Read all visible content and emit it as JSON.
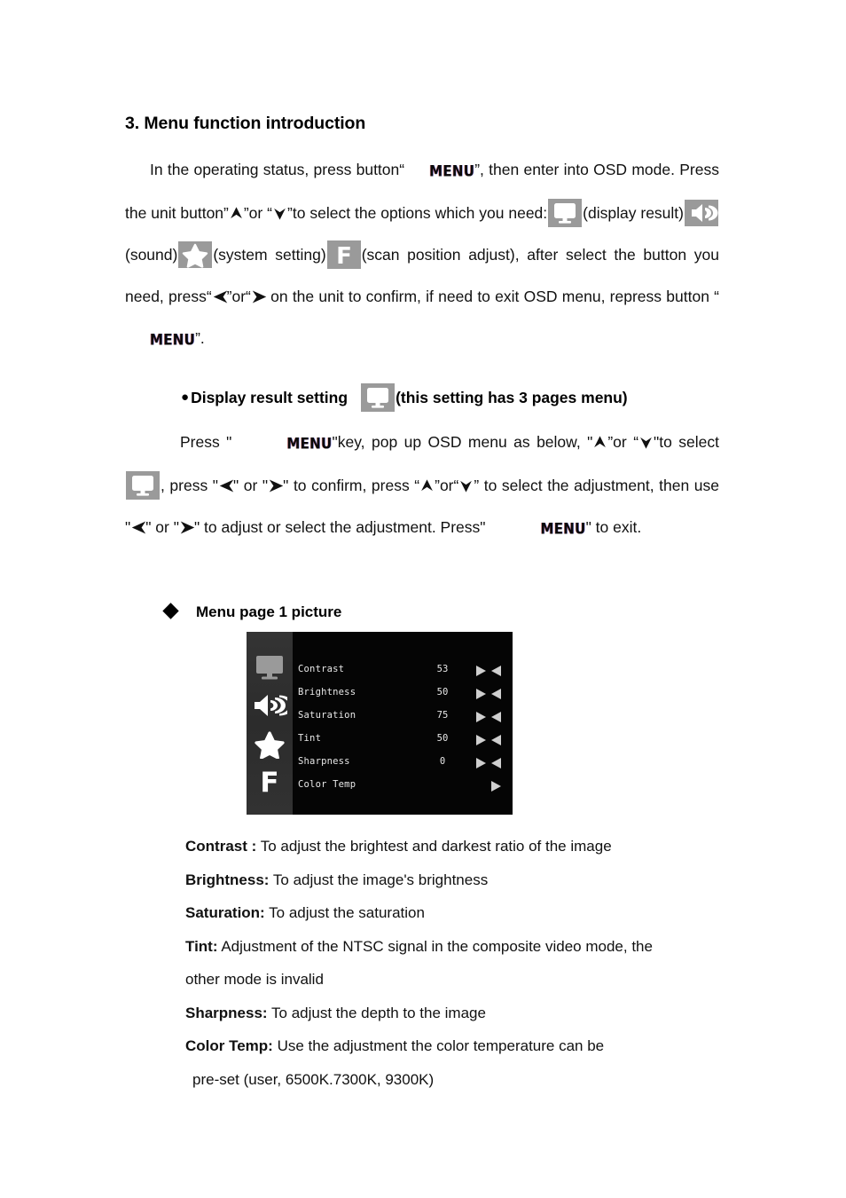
{
  "document": {
    "section_title": "3. Menu function introduction",
    "intro": {
      "seg1": "In the operating status, press button",
      "quote_open": "“",
      "menu_key": "MENU",
      "quote_close": "”",
      "seg2": ", then enter into OSD mode. Press the unit button”",
      "seg3": "”or “",
      "seg4": "”to select the options which you need:",
      "seg5": "(display result)",
      "seg6": "(sound)",
      "seg7": "(system setting)",
      "seg8": "(scan position adjust), after select the button you need, press“",
      "seg9": "”or“",
      "seg10": " on the unit to confirm, if need to exit OSD menu, repress button “",
      "seg11": "”."
    },
    "bullet_heading": {
      "bullet": "●",
      "text": "Display result setting",
      "suffix": "(this setting has 3 pages menu)"
    },
    "press_para": {
      "seg1": "Press \"",
      "menu_key": "MENU",
      "seg2": "\"key, pop up OSD menu as below, \"",
      "seg3": "”or “",
      "seg4": "\"to select",
      "seg5": ", press \"",
      "seg6": "\" or \"",
      "seg7": "\" to confirm, press “",
      "seg8": "”or“",
      "seg9": "” to select the adjustment, then use \"",
      "seg10": "\" or \"",
      "seg11": "\" to adjust or select the adjustment. Press\"",
      "seg12": "\" to exit."
    },
    "menu_page_caption": "Menu page 1 picture",
    "descriptions": [
      {
        "term": "Contrast :",
        "text": "To adjust the brightest and darkest ratio of the image"
      },
      {
        "term": "Brightness:",
        "text": "To adjust the image's brightness"
      },
      {
        "term": "Saturation:",
        "text": "To adjust the saturation"
      },
      {
        "term": "Tint:",
        "text": "Adjustment of the NTSC signal in the composite video mode, the",
        "cont": "other mode is invalid"
      },
      {
        "term": "Sharpness:",
        "text": "To adjust the depth to the image"
      },
      {
        "term": "Color Temp:",
        "text": "Use the adjustment the color temperature can be",
        "cont": "pre-set (user, 6500K.7300K, 9300K)"
      }
    ]
  },
  "osd_menu": {
    "sidebar_icons": [
      {
        "name": "monitor-icon",
        "state": "selected"
      },
      {
        "name": "speaker-icon",
        "state": "normal"
      },
      {
        "name": "star-icon",
        "state": "normal"
      },
      {
        "name": "f-icon",
        "state": "normal"
      }
    ],
    "rows": [
      {
        "label": "Contrast",
        "value": "53",
        "arrows": "both"
      },
      {
        "label": "Brightness",
        "value": "50",
        "arrows": "both"
      },
      {
        "label": "Saturation",
        "value": "75",
        "arrows": "both"
      },
      {
        "label": "Tint",
        "value": "50",
        "arrows": "both"
      },
      {
        "label": "Sharpness",
        "value": "0",
        "arrows": "both"
      },
      {
        "label": "Color Temp",
        "value": "",
        "arrows": "right"
      }
    ]
  },
  "colors": {
    "page_background": "#ffffff",
    "text": "#111111",
    "chip_background": "#9a9a9a",
    "chip_glyph": "#ffffff",
    "osd_background": "#050505",
    "osd_sidebar": "#303030",
    "osd_text": "#e8e8e8",
    "osd_icon_selected": "#9a9a9a",
    "osd_icon_normal": "#ffffff"
  }
}
